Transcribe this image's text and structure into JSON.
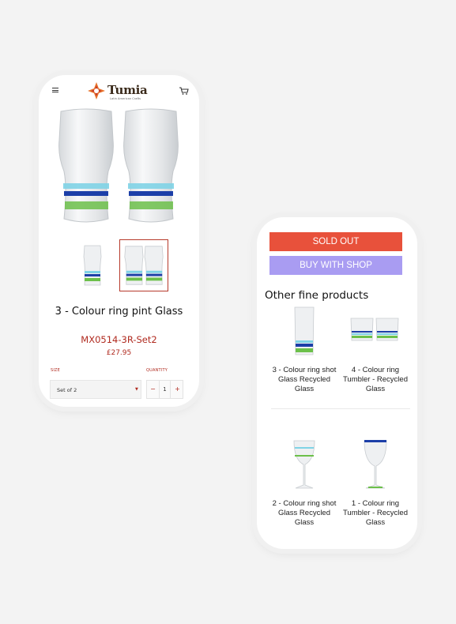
{
  "header": {
    "logo_name": "Tumia",
    "logo_tagline": "Latin American Crafts"
  },
  "product": {
    "title": "3 - Colour ring pint Glass",
    "sku": "MX0514-3R-Set2",
    "price": "£27.95",
    "size_label": "SIZE",
    "size_value": "Set of 2",
    "quantity_label": "QUANTITY",
    "quantity_value": "1",
    "qty_minus": "−",
    "qty_plus": "+"
  },
  "actions": {
    "sold_out_label": "SOLD OUT",
    "buy_label": "BUY WITH SHOP"
  },
  "related": {
    "title": "Other fine products",
    "items": [
      {
        "name": "3 - Colour ring shot Glass Recycled Glass",
        "icon": "shot-glass-image"
      },
      {
        "name": "4 - Colour ring Tumbler - Recycled Glass",
        "icon": "tumbler-pair-image"
      },
      {
        "name": "2 - Colour ring shot Glass Recycled Glass",
        "icon": "wine-glass-image"
      },
      {
        "name": "1 - Colour ring Tumbler - Recycled Glass",
        "icon": "goblet-image"
      }
    ]
  },
  "colors": {
    "accent_red": "#b02a1f",
    "sold_out_bg": "#e8513b",
    "buy_bg": "#a99cf2"
  }
}
